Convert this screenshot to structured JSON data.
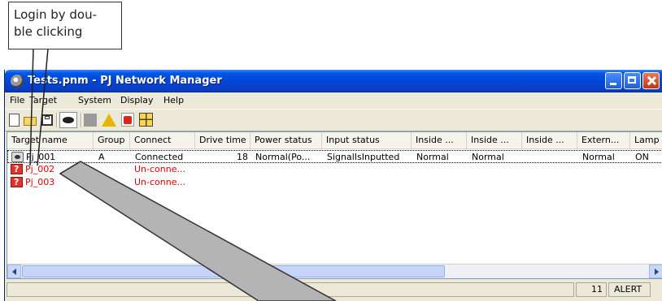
{
  "callout": {
    "line1": "Login by dou-",
    "line2": "ble clicking"
  },
  "window": {
    "title": "Tests.pnm - PJ Network Manager",
    "buttons": [
      "minimize",
      "maximize",
      "close"
    ]
  },
  "menu": [
    "File",
    "Target",
    "System",
    "Display",
    "Help"
  ],
  "toolbar_icons": [
    "new-file-icon",
    "open-folder-icon",
    "save-icon",
    "view-icon",
    "gray-square-icon",
    "alert-icon",
    "alert-mail-icon",
    "grid-icon"
  ],
  "columns": [
    "Target name",
    "Group",
    "Connect",
    "Drive time",
    "Power status",
    "Input status",
    "Inside ...",
    "Inside ...",
    "Inside ...",
    "Extern...",
    "Lamp"
  ],
  "rows": [
    {
      "name": "Pj_001",
      "group": "A",
      "connect": "Connected",
      "drive_time": "18",
      "power": "Normal(Po...",
      "input": "SignalIsInputted",
      "inside1": "Normal",
      "inside2": "Normal",
      "inside3": "",
      "external": "Normal",
      "lamp": "ON",
      "status": "ok"
    },
    {
      "name": "Pj_002",
      "group": "",
      "connect": "Un-conne...",
      "drive_time": "",
      "power": "",
      "input": "",
      "inside1": "",
      "inside2": "",
      "inside3": "",
      "external": "",
      "lamp": "",
      "status": "error"
    },
    {
      "name": "Pj_003",
      "group": "---",
      "connect": "Un-conne...",
      "drive_time": "",
      "power": "",
      "input": "",
      "inside1": "",
      "inside2": "",
      "inside3": "",
      "external": "",
      "lamp": "",
      "status": "error"
    }
  ],
  "status": {
    "count": "11",
    "alert": "ALERT"
  },
  "colors": {
    "titlebar": "#0046d5",
    "error_text": "#e00000",
    "beam": "#b4b4b4"
  }
}
